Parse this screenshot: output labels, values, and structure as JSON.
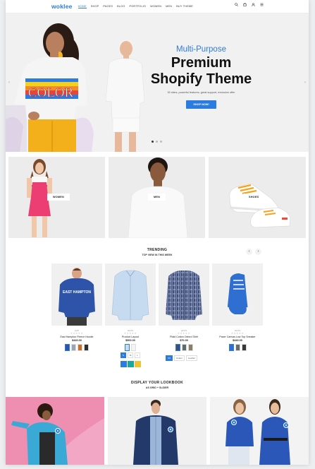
{
  "header": {
    "logo": "woklee",
    "nav": [
      "HOME",
      "SHOP",
      "PAGES",
      "BLOG",
      "PORTFOLIO",
      "WOMEN",
      "MEN",
      "BUY THEME"
    ],
    "icons": [
      "search-icon",
      "cart-icon",
      "user-icon",
      "menu-icon"
    ]
  },
  "hero": {
    "subtitle": "Multi-Purpose",
    "title_line1": "Premium",
    "title_line2": "Shopify Theme",
    "description": "30 skins, powerful features, great support, exclusive offer",
    "button": "SHOP NOW!",
    "shirt_text": "COLOR",
    "slides": 3,
    "active_slide": 1
  },
  "categories": [
    {
      "label": "WOMEN"
    },
    {
      "label": "MEN"
    },
    {
      "label": "SHOES"
    }
  ],
  "trending": {
    "title": "TRENDING",
    "subtitle": "TOP VIEW IN THIS WEEK",
    "products": [
      {
        "vendor": "GAP",
        "name": "East Hampton Fleece Hoodie",
        "price": "$440.00",
        "logo_text": "EAST HAMPTON"
      },
      {
        "vendor": "LEVIS",
        "name": "Product Layout",
        "price": "$500.00"
      },
      {
        "vendor": "LEVIS",
        "name": "Plaid Cotton Oxford Shirt",
        "price": "$70.00"
      },
      {
        "vendor": "LEVIS",
        "name": "Pacer Canvas Low Top Sneaker",
        "price": "$440.00"
      }
    ],
    "sizes_b": [
      "S",
      "M",
      "L"
    ],
    "sizes_c": [
      "XS",
      "Cotton",
      "Leather"
    ]
  },
  "lookbook": {
    "title": "DISPLAY YOUR LOOKBOOK",
    "subtitle": "AS GRID + SLIDER"
  },
  "colors": {
    "accent": "#2b7be0"
  }
}
